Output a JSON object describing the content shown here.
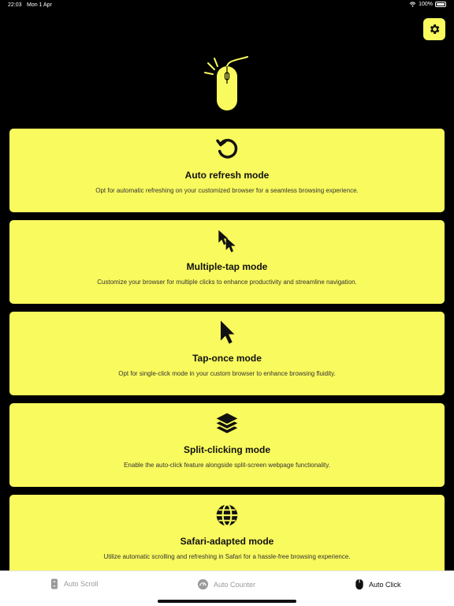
{
  "status": {
    "time": "22:03",
    "date": "Mon 1 Apr",
    "battery": "100%"
  },
  "cards": [
    {
      "title": "Auto refresh mode",
      "desc": "Opt for automatic refreshing on your customized browser for a seamless browsing experience.",
      "icon": "refresh-icon"
    },
    {
      "title": "Multiple-tap mode",
      "desc": "Customize your browser for multiple clicks to enhance productivity and streamline navigation.",
      "icon": "multi-cursor-icon"
    },
    {
      "title": "Tap-once mode",
      "desc": "Opt for single-click mode in your custom browser to enhance browsing fluidity.",
      "icon": "cursor-icon"
    },
    {
      "title": "Split-clicking mode",
      "desc": "Enable the auto-click feature alongside split-screen webpage functionality.",
      "icon": "layers-icon"
    },
    {
      "title": "Safari-adapted mode",
      "desc": "Utilize automatic scrolling and refreshing in Safari for a hassle-free browsing experience.",
      "icon": "globe-icon"
    }
  ],
  "tabs": [
    {
      "label": "Auto Scroll",
      "icon": "scroll-icon",
      "active": false
    },
    {
      "label": "Auto Counter",
      "icon": "counter-icon",
      "active": false
    },
    {
      "label": "Auto Click",
      "icon": "mouse-icon",
      "active": true
    }
  ],
  "colors": {
    "accent": "#f9fa5d",
    "background": "#000000",
    "tab_bar": "#ffffff"
  }
}
